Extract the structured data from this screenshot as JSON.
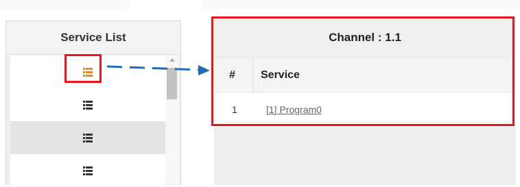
{
  "left_panel": {
    "title": "Service List",
    "rows": [
      {
        "icon": "list-icon",
        "selected": true
      },
      {
        "icon": "list-icon",
        "selected": false
      },
      {
        "icon": "list-icon",
        "selected": false
      },
      {
        "icon": "list-icon",
        "selected": false
      }
    ]
  },
  "right_panel": {
    "title": "Channel : 1.1",
    "columns": [
      "#",
      "Service"
    ],
    "rows": [
      {
        "num": "1",
        "service": "[1] Program0"
      }
    ]
  },
  "colors": {
    "annotation": "#e8141c",
    "arrow": "#1f6bb8",
    "selected_icon": "#f0841e",
    "icon": "#333333"
  }
}
